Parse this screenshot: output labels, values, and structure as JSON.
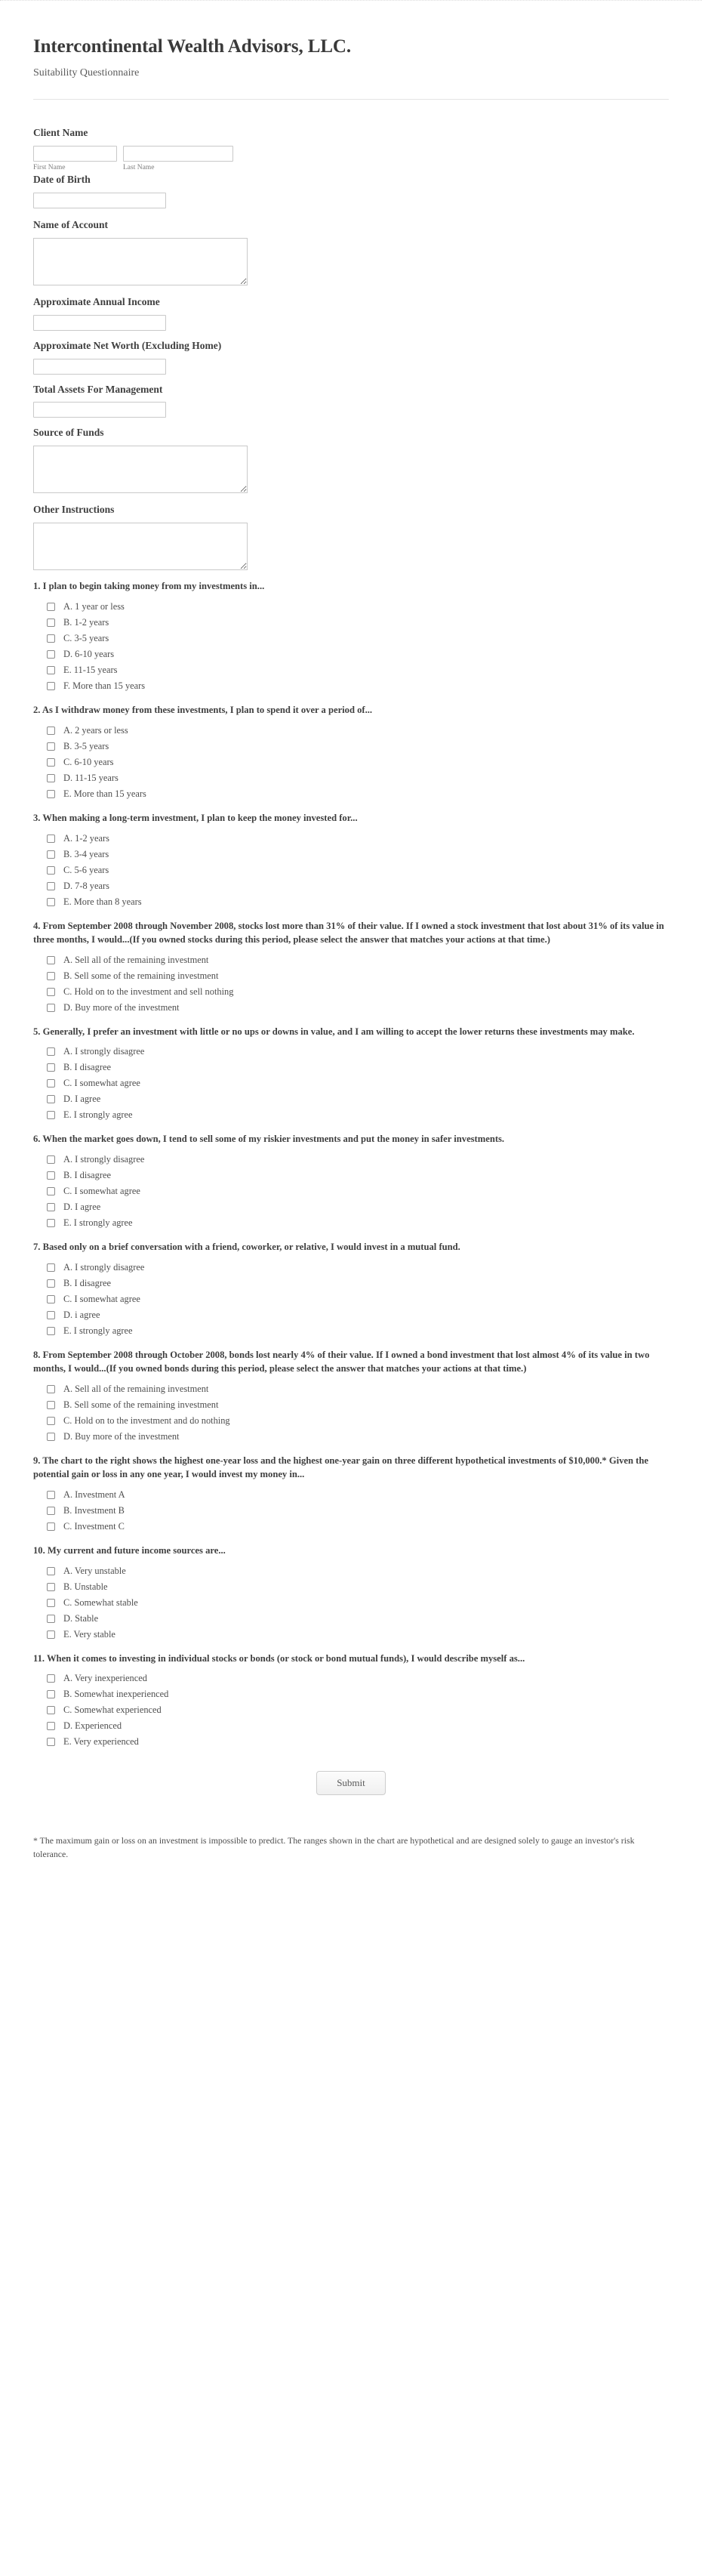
{
  "header": {
    "title": "Intercontinental Wealth Advisors, LLC.",
    "subtitle": "Suitability Questionnaire"
  },
  "fields": {
    "client_name": {
      "label": "Client Name",
      "first": {
        "value": "",
        "sub_label": "First Name"
      },
      "last": {
        "value": "",
        "sub_label": "Last Name"
      }
    },
    "date_of_birth": {
      "label": "Date of Birth",
      "value": ""
    },
    "name_of_account": {
      "label": "Name of Account",
      "value": ""
    },
    "annual_income": {
      "label": "Approximate Annual Income",
      "value": ""
    },
    "net_worth": {
      "label": "Approximate Net Worth (Excluding Home)",
      "value": ""
    },
    "total_assets": {
      "label": "Total Assets For Management",
      "value": ""
    },
    "source_of_funds": {
      "label": "Source of Funds",
      "value": ""
    },
    "other_instructions": {
      "label": "Other Instructions",
      "value": ""
    }
  },
  "questions": [
    {
      "text": "1. I plan to begin taking money from my investments in...",
      "options": [
        "A. 1 year or less",
        "B. 1-2 years",
        "C. 3-5 years",
        "D. 6-10 years",
        "E. 11-15 years",
        "F. More than 15 years"
      ]
    },
    {
      "text": "2. As I withdraw money from these investments, I plan to spend it over a period of...",
      "options": [
        "A. 2 years or less",
        "B. 3-5 years",
        "C. 6-10 years",
        "D. 11-15 years",
        "E. More than 15 years"
      ]
    },
    {
      "text": "3. When making a long-term investment, I plan to keep the money invested for...",
      "options": [
        "A. 1-2 years",
        "B. 3-4 years",
        "C. 5-6 years",
        "D. 7-8 years",
        "E. More than 8 years"
      ]
    },
    {
      "text": "4. From September 2008 through November 2008, stocks lost more than 31% of their value. If I owned a stock investment that lost about 31% of its value in three months, I would...(If you owned stocks during this period, please select the answer that matches your actions at that time.)",
      "options": [
        "A. Sell all of the remaining investment",
        "B. Sell some of the remaining investment",
        "C. Hold on to the investment and sell nothing",
        "D. Buy more of the investment"
      ]
    },
    {
      "text": "5. Generally, I prefer an investment with little or no ups or downs in value, and I am willing to accept the lower returns these investments may make.",
      "options": [
        "A. I strongly disagree",
        "B. I disagree",
        "C. I somewhat agree",
        "D. I agree",
        "E. I strongly agree"
      ]
    },
    {
      "text": "6. When the market goes down, I tend to sell some of my riskier investments and put the money in safer investments.",
      "options": [
        "A. I strongly disagree",
        "B. I disagree",
        "C. I somewhat agree",
        "D. I agree",
        "E. I strongly agree"
      ]
    },
    {
      "text": "7. Based only on a brief conversation with a friend, coworker, or relative, I would invest in a mutual fund.",
      "options": [
        "A. I strongly disagree",
        "B. I disagree",
        "C. I somewhat agree",
        "D. i agree",
        "E. I strongly agree"
      ]
    },
    {
      "text": "8. From September 2008 through October 2008, bonds lost nearly 4% of their value. If I owned a bond investment that lost almost 4% of its value in two months, I would...(If you owned bonds during this period, please select the answer that matches your actions at that time.)",
      "options": [
        "A. Sell all of the remaining investment",
        "B. Sell some of the remaining investment",
        "C. Hold on to the investment and do nothing",
        "D. Buy more of the investment"
      ]
    },
    {
      "text": "9. The chart to the right shows the highest one-year loss and the highest one-year gain on three different hypothetical investments of $10,000.* Given the potential gain or loss in any one year, I would invest my money in...",
      "options": [
        "A. Investment A",
        "B. Investment B",
        "C. Investment C"
      ]
    },
    {
      "text": "10. My current and future income sources are...",
      "options": [
        "A. Very unstable",
        "B. Unstable",
        "C. Somewhat stable",
        "D. Stable",
        "E. Very stable"
      ]
    },
    {
      "text": "11. When it comes to investing in individual stocks or bonds (or stock or bond mutual funds), I would describe myself as...",
      "options": [
        "A. Very inexperienced",
        "B. Somewhat inexperienced",
        "C. Somewhat experienced",
        "D. Experienced",
        "E. Very experienced"
      ]
    }
  ],
  "submit": {
    "label": "Submit"
  },
  "footnote": "* The maximum gain or loss on an investment is impossible to predict. The ranges shown in the chart are hypothetical and are designed solely to gauge an investor's risk tolerance."
}
